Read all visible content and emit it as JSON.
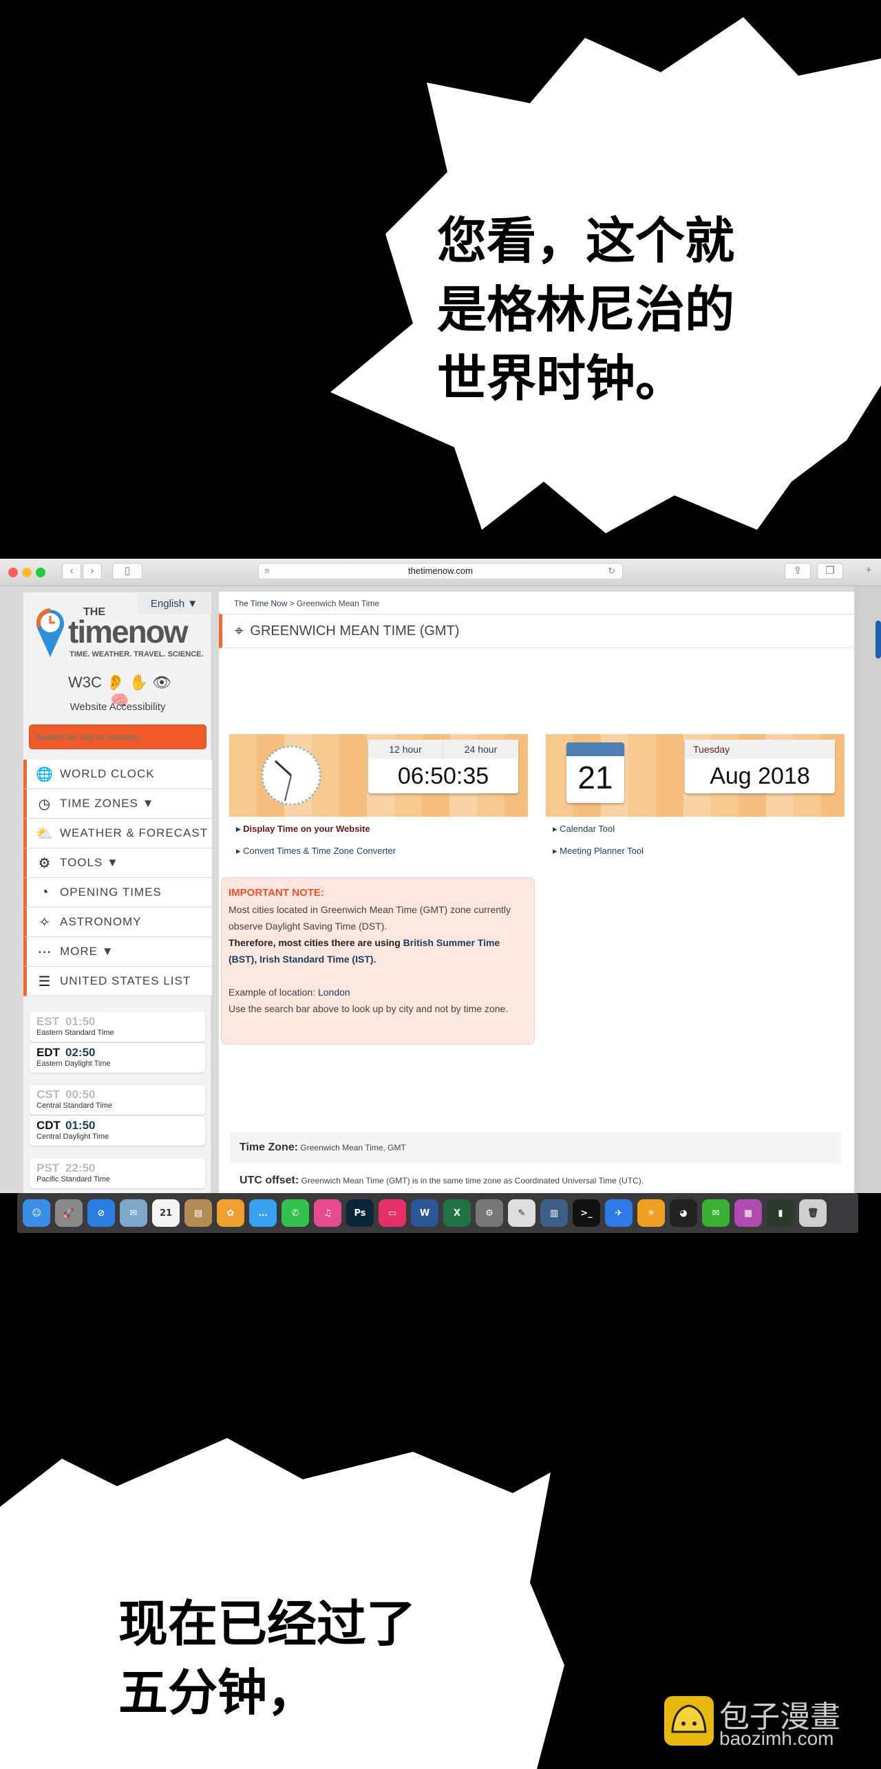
{
  "comic": {
    "top_bubble": "您看，这个就\n是格林尼治的\n世界时钟。",
    "bottom_bubble": "现在已经过了\n五分钟，",
    "watermark_cn": "包子漫畫",
    "watermark_url": "baozimh.com"
  },
  "browser": {
    "url": "thetimenow.com"
  },
  "sidebar": {
    "language": "English ▼",
    "logo_the": "THE",
    "logo_name": "timenow",
    "logo_tagline": "TIME. WEATHER. TRAVEL. SCIENCE.",
    "accessibility_icons": "W3C 👂 ✋ 👁 🧠",
    "accessibility_label": "Website Accessibility",
    "search_placeholder": "Search for city or country...",
    "menu": [
      {
        "icon": "globe-icon",
        "glyph": "🌐",
        "label": "WORLD CLOCK"
      },
      {
        "icon": "clock-icon",
        "glyph": "◷",
        "label": "TIME ZONES ▼"
      },
      {
        "icon": "weather-icon",
        "glyph": "⛅",
        "label": "WEATHER & FORECAST"
      },
      {
        "icon": "gear-icon",
        "glyph": "⚙",
        "label": "TOOLS ▼"
      },
      {
        "icon": "opening-times-icon",
        "glyph": "◔",
        "label": "OPENING TIMES"
      },
      {
        "icon": "sparkles-icon",
        "glyph": "✧",
        "label": "ASTRONOMY"
      },
      {
        "icon": "more-icon",
        "glyph": "⋯",
        "label": "MORE ▼"
      },
      {
        "icon": "list-icon",
        "glyph": "☰",
        "label": "UNITED STATES LIST"
      }
    ],
    "zones": [
      {
        "abbr": "EST",
        "time": "01:50",
        "name": "Eastern Standard Time",
        "active": false
      },
      {
        "abbr": "EDT",
        "time": "02:50",
        "name": "Eastern Daylight Time",
        "active": true
      },
      {
        "abbr": "CST",
        "time": "00:50",
        "name": "Central Standard Time",
        "active": false
      },
      {
        "abbr": "CDT",
        "time": "01:50",
        "name": "Central Daylight Time",
        "active": true
      },
      {
        "abbr": "PST",
        "time": "22:50",
        "name": "Pacific Standard Time",
        "active": false
      }
    ]
  },
  "main": {
    "breadcrumb_home": "The Time Now",
    "breadcrumb_sep": " > ",
    "breadcrumb_current": "Greenwich Mean Time",
    "title": "GREENWICH MEAN TIME (GMT)",
    "clock": {
      "tab_12": "12 hour",
      "tab_24": "24 hour",
      "time": "06:50:35"
    },
    "date": {
      "day": "21",
      "weekday": "Tuesday",
      "month_year": "Aug 2018"
    },
    "links_left": [
      "Display Time on your Website",
      "Convert Times & Time Zone Converter"
    ],
    "links_right": [
      "Calendar Tool",
      "Meeting Planner Tool"
    ],
    "note": {
      "heading": "IMPORTANT NOTE:",
      "line1": "Most cities located in Greenwich Mean Time (GMT) zone currently observe Daylight Saving Time (DST).",
      "line2_bold": "Therefore, most cities there are using ",
      "line2_link": "British Summer Time (BST), Irish Standard Time (IST).",
      "example_label": "Example of location: ",
      "example_link": "London",
      "hint": "Use the search bar above to look up by city and not by time zone."
    },
    "timezone_label": "Time Zone:",
    "timezone_value": "Greenwich Mean Time, GMT",
    "utc_label": "UTC offset:",
    "utc_value": "Greenwich Mean Time (GMT) is in the same time zone as Coordinated Universal Time (UTC)."
  },
  "dock": [
    {
      "name": "finder",
      "label": "☺",
      "color": "#3b8ee8"
    },
    {
      "name": "launchpad",
      "label": "🚀",
      "color": "#8a8a8a"
    },
    {
      "name": "safari",
      "label": "⊘",
      "color": "#2a7de1"
    },
    {
      "name": "mail",
      "label": "✉",
      "color": "#7fa7c9"
    },
    {
      "name": "calendar",
      "label": "21",
      "color": "#f4f4f4"
    },
    {
      "name": "contacts",
      "label": "▤",
      "color": "#b48a55"
    },
    {
      "name": "photos",
      "label": "✿",
      "color": "#f0a030"
    },
    {
      "name": "messages",
      "label": "…",
      "color": "#3aa0f0"
    },
    {
      "name": "facetime",
      "label": "✆",
      "color": "#35c14d"
    },
    {
      "name": "itunes",
      "label": "♫",
      "color": "#e84a8f"
    },
    {
      "name": "photoshop",
      "label": "Ps",
      "color": "#0b2538"
    },
    {
      "name": "cleanmymac",
      "label": "▭",
      "color": "#e6306a"
    },
    {
      "name": "word",
      "label": "W",
      "color": "#2b5797"
    },
    {
      "name": "excel",
      "label": "X",
      "color": "#1f7244"
    },
    {
      "name": "system-preferences",
      "label": "⚙",
      "color": "#777"
    },
    {
      "name": "textedit",
      "label": "✎",
      "color": "#ddd"
    },
    {
      "name": "mission-control",
      "label": "▥",
      "color": "#3c5f8a"
    },
    {
      "name": "terminal",
      "label": ">_",
      "color": "#111"
    },
    {
      "name": "feishu",
      "label": "✈",
      "color": "#2e7be6"
    },
    {
      "name": "sunflower",
      "label": "☀",
      "color": "#f0a020"
    },
    {
      "name": "qq",
      "label": "◕",
      "color": "#222"
    },
    {
      "name": "wechat",
      "label": "✉",
      "color": "#3cb034"
    },
    {
      "name": "archiver",
      "label": "▦",
      "color": "#b04ab0"
    },
    {
      "name": "battery",
      "label": "▮",
      "color": "#2a3a2a"
    },
    {
      "name": "trash",
      "label": "🗑",
      "color": "#cfcfcf"
    }
  ],
  "colors": {
    "accent": "#ef6a2c",
    "link": "#1d3e5c",
    "note_bg": "#fce6e0"
  }
}
